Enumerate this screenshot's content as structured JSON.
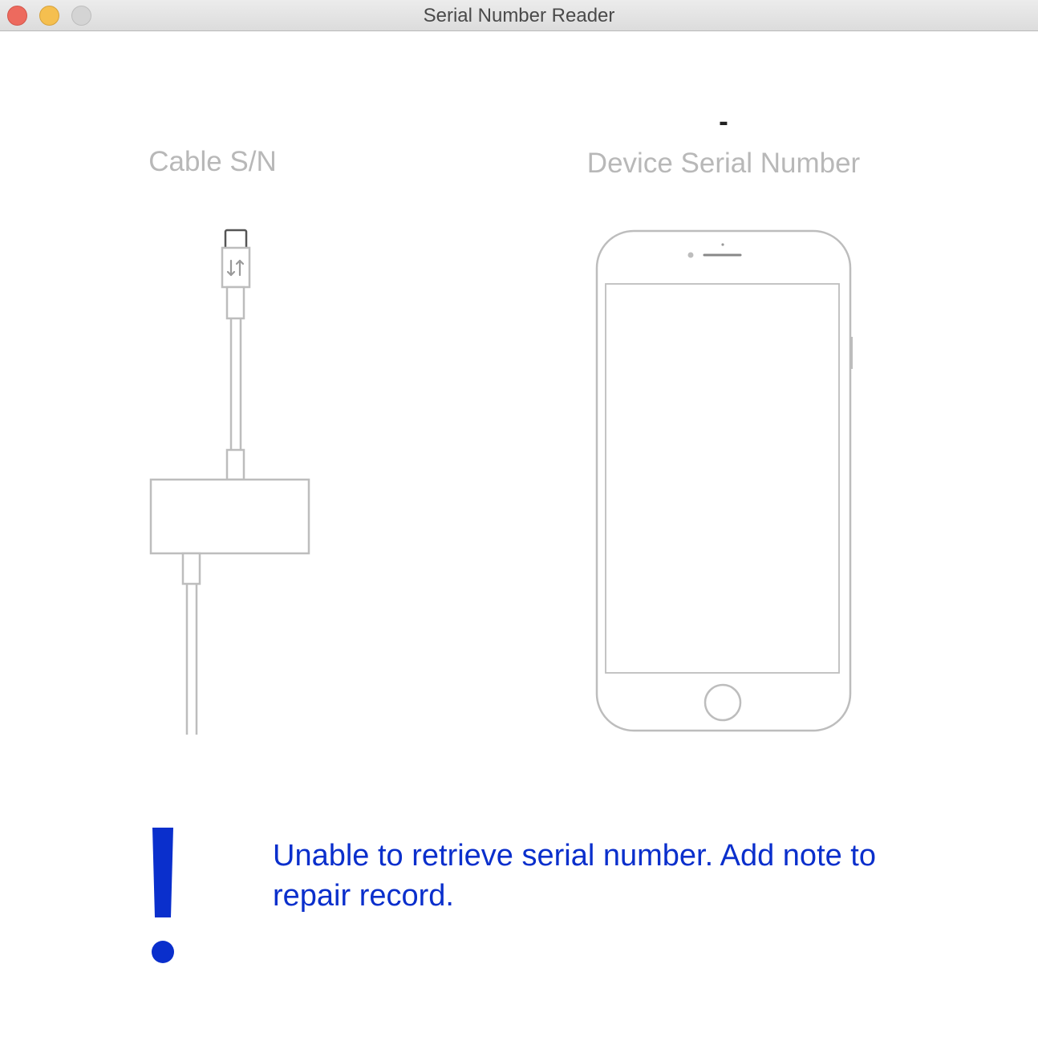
{
  "window": {
    "title": "Serial Number Reader"
  },
  "traffic_lights": {
    "close": "close-button",
    "minimize": "minimize-button",
    "zoom": "zoom-button"
  },
  "cable": {
    "label": "Cable S/N",
    "icon": "usb-c-adapter-icon"
  },
  "device": {
    "serial_value": "-",
    "label": "Device Serial Number",
    "icon": "iphone-outline-icon"
  },
  "alert": {
    "icon": "exclamation-icon",
    "message": "Unable to retrieve serial number. Add note to repair record.",
    "color": "#0a2fcc"
  },
  "colors": {
    "label_gray": "#b8b8b8",
    "outline_gray": "#bdbdbd",
    "close": "#ed6a5e",
    "minimize": "#f5bf4f",
    "zoom_disabled": "#d4d4d4"
  }
}
